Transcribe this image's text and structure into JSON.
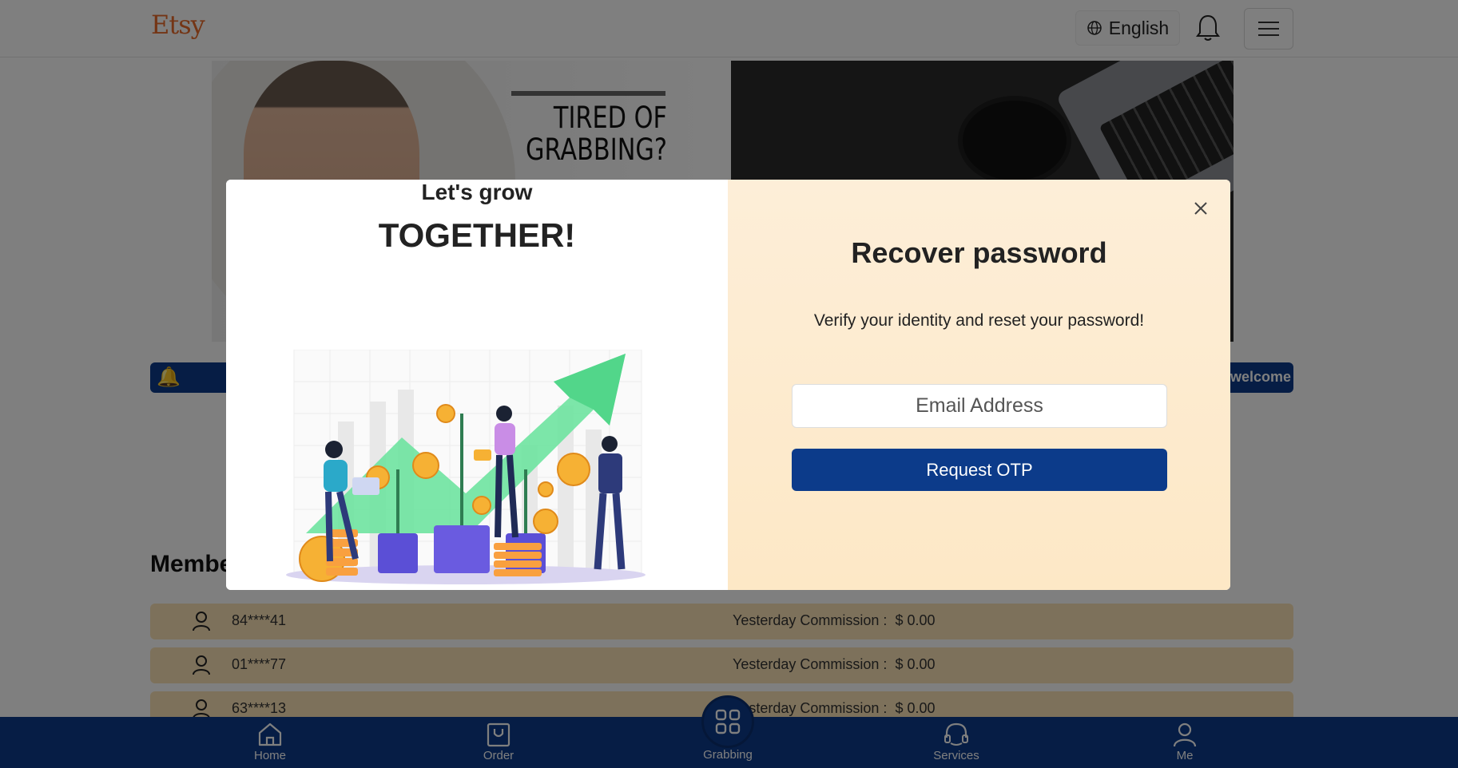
{
  "header": {
    "logo": "Etsy",
    "language_label": "English"
  },
  "banners": {
    "left_headline": "TIRED OF GRABBING?"
  },
  "notice": {
    "text": "welcome"
  },
  "members": {
    "title": "Member",
    "commission_label": "Yesterday Commission :",
    "rows": [
      {
        "id": "84****41",
        "commission": "$ 0.00"
      },
      {
        "id": "01****77",
        "commission": "$ 0.00"
      },
      {
        "id": "63****13",
        "commission": "$ 0.00"
      }
    ]
  },
  "nav": {
    "home": "Home",
    "order": "Order",
    "grabbing": "Grabbing",
    "services": "Services",
    "me": "Me"
  },
  "modal": {
    "left_line1": "Let's grow",
    "left_line2": "TOGETHER!",
    "title": "Recover password",
    "subtitle": "Verify your identity and reset your password!",
    "email_placeholder": "Email Address",
    "submit_label": "Request OTP"
  },
  "colors": {
    "brand_blue": "#0c3b8a",
    "logo_orange": "#e86a2a",
    "row_bg": "#fbe3b6",
    "modal_right_bg": "#fdeed8"
  },
  "icons": [
    "globe-icon",
    "bell-icon",
    "hamburger-menu-icon",
    "speaker-icon",
    "user-icon",
    "home-icon",
    "order-bag-icon",
    "grid-icon",
    "headset-icon",
    "person-icon",
    "close-icon"
  ]
}
